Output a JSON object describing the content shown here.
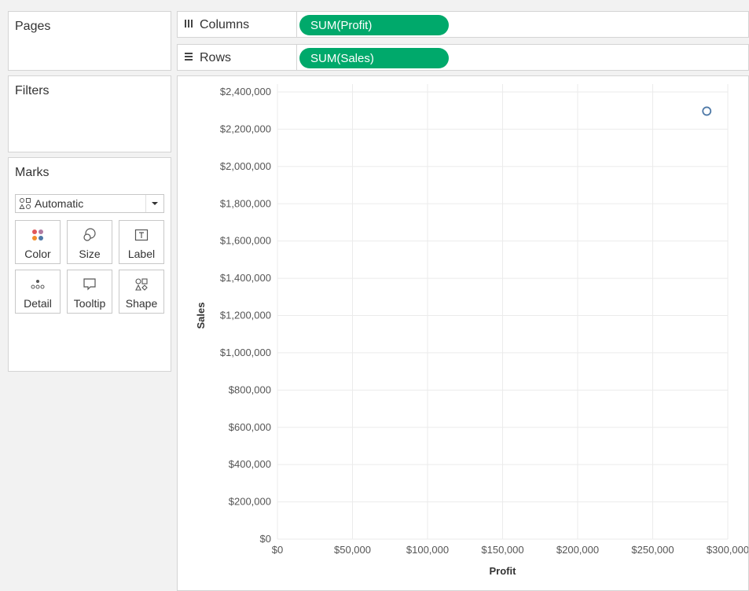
{
  "pages": {
    "title": "Pages"
  },
  "filters": {
    "title": "Filters"
  },
  "marks": {
    "title": "Marks",
    "mark_type": "Automatic",
    "buttons": [
      {
        "label": "Color",
        "icon": "color-dots-icon"
      },
      {
        "label": "Size",
        "icon": "size-icon"
      },
      {
        "label": "Label",
        "icon": "label-text-icon"
      },
      {
        "label": "Detail",
        "icon": "detail-dots-icon"
      },
      {
        "label": "Tooltip",
        "icon": "tooltip-speech-icon"
      },
      {
        "label": "Shape",
        "icon": "shape-icon"
      }
    ]
  },
  "shelves": {
    "columns": {
      "label": "Columns",
      "pill": "SUM(Profit)"
    },
    "rows": {
      "label": "Rows",
      "pill": "SUM(Sales)"
    }
  },
  "colors": {
    "pill": "#00a96b",
    "mark": "#4e79a7",
    "grid": "#ebebeb"
  },
  "chart_data": {
    "type": "scatter",
    "xlabel": "Profit",
    "ylabel": "Sales",
    "xlim": [
      0,
      300000
    ],
    "ylim": [
      0,
      2400000
    ],
    "x_ticks": [
      0,
      50000,
      100000,
      150000,
      200000,
      250000,
      300000
    ],
    "x_tick_labels": [
      "$0",
      "$50,000",
      "$100,000",
      "$150,000",
      "$200,000",
      "$250,000",
      "$300,000"
    ],
    "y_ticks": [
      0,
      200000,
      400000,
      600000,
      800000,
      1000000,
      1200000,
      1400000,
      1600000,
      1800000,
      2000000,
      2200000,
      2400000
    ],
    "y_tick_labels": [
      "$0",
      "$200,000",
      "$400,000",
      "$600,000",
      "$800,000",
      "$1,000,000",
      "$1,200,000",
      "$1,400,000",
      "$1,600,000",
      "$1,800,000",
      "$2,000,000",
      "$2,200,000",
      "$2,400,000"
    ],
    "points": [
      {
        "x": 286000,
        "y": 2297000
      }
    ],
    "grid": true
  }
}
